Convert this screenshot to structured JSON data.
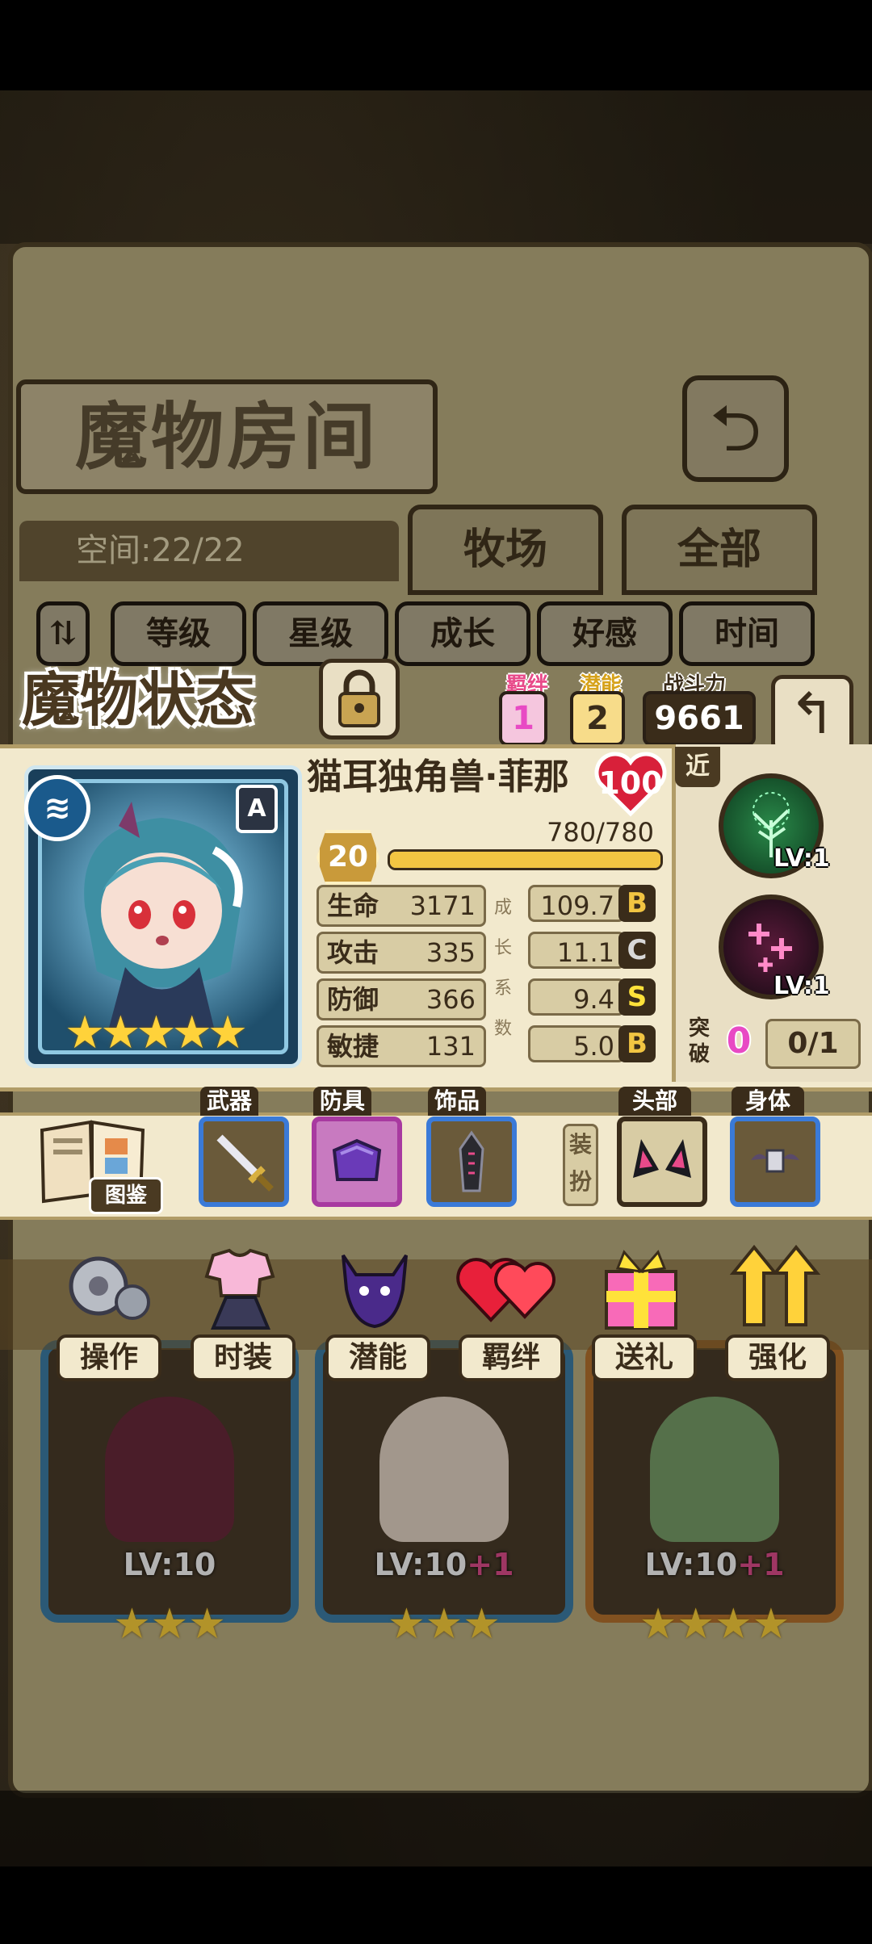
{
  "room": {
    "title": "魔物房间",
    "space": "空间:22/22",
    "tabs": [
      "牧场",
      "全部"
    ],
    "sort_buttons": [
      "等级",
      "星级",
      "成长",
      "好感",
      "时间"
    ]
  },
  "background_cards": [
    {
      "level": "LV:10",
      "plus": "",
      "stars": "★★★"
    },
    {
      "level": "LV:10",
      "plus": "+1",
      "stars": "★★★"
    },
    {
      "level": "LV:10",
      "plus": "+1",
      "stars": "★★★★"
    }
  ],
  "status": {
    "title": "魔物状态",
    "bond_label": "羁绊",
    "bond_value": "1",
    "potential_label": "潜能",
    "potential_value": "2",
    "power_label": "战斗力",
    "power_value": "9661",
    "name": "猫耳独角兽·菲那",
    "affection": "100",
    "rank": "A",
    "stars": "★★★★★",
    "level": "20",
    "exp": "780/780",
    "exp_fraction": 1.0,
    "stats": [
      {
        "name": "生命",
        "value": "3171",
        "growth": "109.7",
        "grade": "B"
      },
      {
        "name": "攻击",
        "value": "335",
        "growth": "11.1",
        "grade": "C"
      },
      {
        "name": "防御",
        "value": "366",
        "growth": "9.4",
        "grade": "S"
      },
      {
        "name": "敏捷",
        "value": "131",
        "growth": "5.0",
        "grade": "B"
      }
    ],
    "growth_vertical": [
      "成",
      "长",
      "系",
      "数"
    ],
    "range_tag": "近",
    "skills": [
      {
        "icon": "tree-skill-icon",
        "level": "LV:1"
      },
      {
        "icon": "cross-sparkle-skill-icon",
        "level": "LV:1"
      }
    ],
    "breakthrough_label": "突破",
    "breakthrough_value": "0",
    "breakthrough_count": "0/1"
  },
  "equipment": {
    "codex_label": "图鉴",
    "slots": [
      {
        "label": "武器",
        "icon": "sword-icon"
      },
      {
        "label": "防具",
        "icon": "armor-icon"
      },
      {
        "label": "饰品",
        "icon": "crystal-icon"
      },
      {
        "label": "头部",
        "icon": "cat-ears-icon"
      },
      {
        "label": "身体",
        "icon": "wing-badge-icon"
      }
    ],
    "dress_label": "装扮"
  },
  "actions": [
    {
      "label": "操作",
      "icon": "gear-icon"
    },
    {
      "label": "时装",
      "icon": "outfit-icon"
    },
    {
      "label": "潜能",
      "icon": "demon-icon"
    },
    {
      "label": "羁绊",
      "icon": "hearts-icon"
    },
    {
      "label": "送礼",
      "icon": "gift-icon"
    },
    {
      "label": "强化",
      "icon": "up-arrows-icon"
    }
  ],
  "colors": {
    "panel": "#f2e9cd",
    "border": "#3a2c1a",
    "accent_pink": "#e84ac4",
    "grade_yellow": "#f2c542"
  }
}
